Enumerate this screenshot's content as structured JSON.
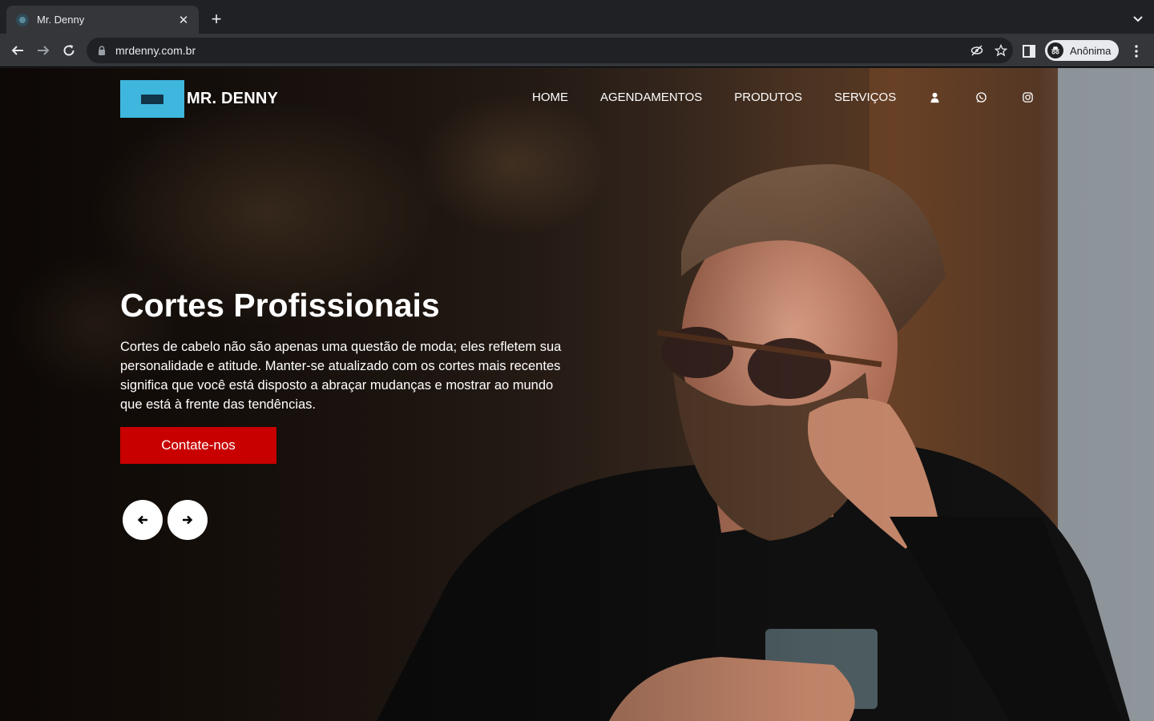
{
  "browser": {
    "tab_title": "Mr. Denny",
    "url": "mrdenny.com.br",
    "profile_label": "Anônima"
  },
  "site": {
    "brand": "MR. DENNY",
    "nav": {
      "home": "HOME",
      "agendamentos": "AGENDAMENTOS",
      "produtos": "PRODUTOS",
      "servicos": "SERVIÇOS"
    },
    "nav_icons": [
      "user-icon",
      "whatsapp-icon",
      "instagram-icon"
    ],
    "hero": {
      "title": "Cortes Profissionais",
      "description": "Cortes de cabelo não são apenas uma questão de moda; eles refletem sua personalidade e atitude. Manter-se atualizado com os cortes mais recentes significa que você está disposto a abraçar mudanças e mostrar ao mundo que está à frente das tendências.",
      "cta_label": "Contate-nos"
    }
  },
  "colors": {
    "cta": "#c80000",
    "logo_bg": "#3fb6de",
    "chrome_dark": "#202124",
    "chrome_toolbar": "#35363a"
  }
}
